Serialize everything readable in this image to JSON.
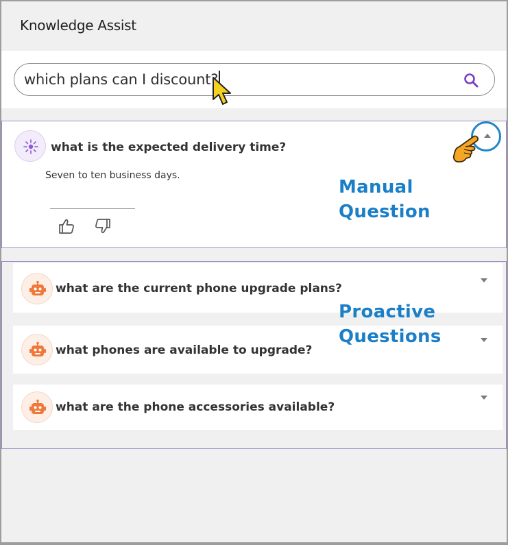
{
  "app": {
    "title": "Knowledge Assist"
  },
  "search": {
    "value": "which plans can I discount?",
    "icon": "search-icon"
  },
  "manual": {
    "question": "what is the expected delivery time?",
    "answer": "Seven to ten business days.",
    "avatar_icon": "sparkle-icon",
    "feedback": {
      "up_icon": "thumbs-up-icon",
      "down_icon": "thumbs-down-icon"
    },
    "collapse_icon": "chevron-up-icon"
  },
  "proactive": {
    "items": [
      {
        "question": "what are the current phone upgrade plans?",
        "icon": "robot-icon"
      },
      {
        "question": "what phones are available to upgrade?",
        "icon": "robot-icon"
      },
      {
        "question": "what are the phone accessories available?",
        "icon": "robot-icon"
      }
    ]
  },
  "annotations": {
    "manual_line1": "Manual",
    "manual_line2": "Question",
    "proactive_line1": "Proactive",
    "proactive_line2": "Questions",
    "color": "#1b7fc7"
  },
  "colors": {
    "accent_purple": "#7b3fc4",
    "bot_orange": "#f0793a",
    "callout_blue": "#1f86c8",
    "cursor_yellow": "#f5c518"
  }
}
